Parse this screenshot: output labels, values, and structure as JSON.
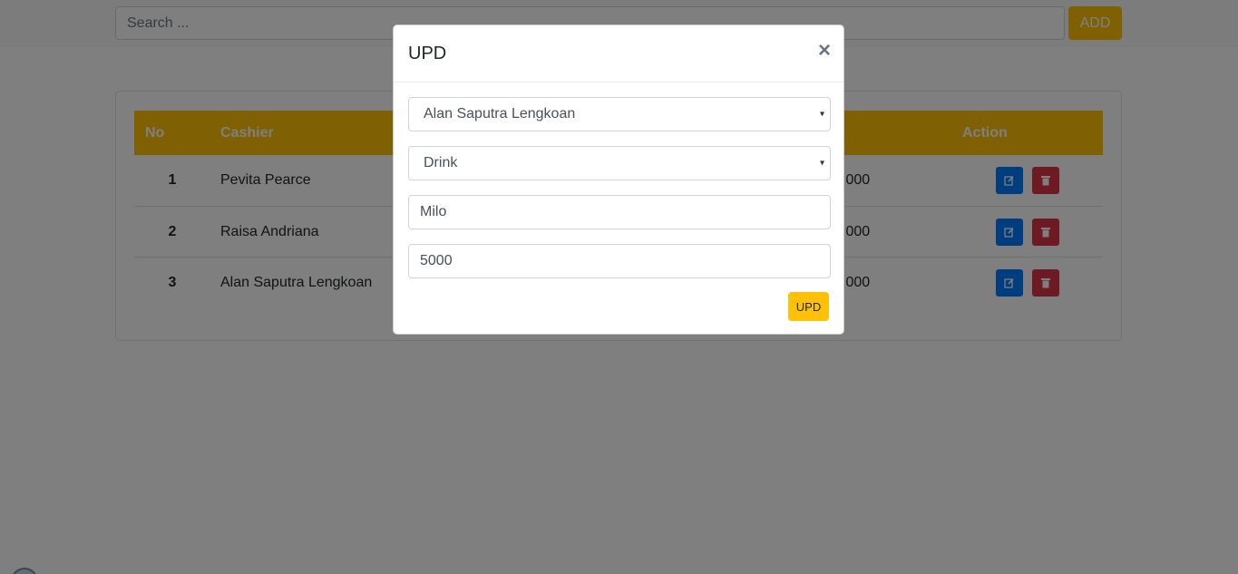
{
  "search": {
    "placeholder": "Search ...",
    "add_label": "ADD"
  },
  "table": {
    "headers": {
      "no": "No",
      "cashier": "Cashier",
      "action": "Action"
    },
    "rows": [
      {
        "no": "1",
        "cashier": "Pevita Pearce",
        "price_tail": ",000"
      },
      {
        "no": "2",
        "cashier": "Raisa Andriana",
        "price_tail": ",000"
      },
      {
        "no": "3",
        "cashier": "Alan Saputra Lengkoan",
        "price_tail": ",000"
      }
    ]
  },
  "modal": {
    "title": "UPD",
    "close": "×",
    "cashier_select": "Alan Saputra Lengkoan",
    "category_select": "Drink",
    "name_value": "Milo",
    "price_value": "5000",
    "submit_label": "UPD"
  },
  "icons": {
    "caret": "▾",
    "edit": "edit-icon",
    "delete": "trash-icon"
  },
  "colors": {
    "accent": "#ffc107",
    "edit": "#007bff",
    "delete": "#dc3545"
  }
}
